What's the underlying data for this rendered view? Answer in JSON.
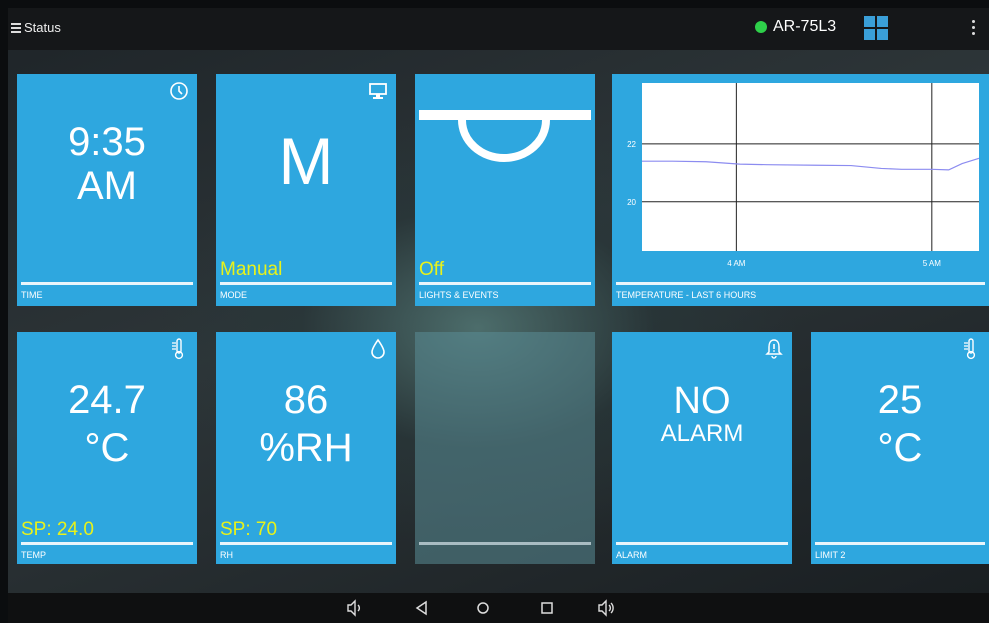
{
  "statusbar": {
    "title": "Status",
    "device_name": "AR-75L3",
    "connection_color": "#2ed04a",
    "icons": [
      "hamburger-icon",
      "dashboard-grid-icon",
      "overflow-menu-icon"
    ]
  },
  "tiles": {
    "time": {
      "value_line1": "9:35",
      "value_line2": "AM",
      "label": "TIME",
      "icon": "clock-icon"
    },
    "mode": {
      "value": "M",
      "sub": "Manual",
      "label": "MODE",
      "icon": "monitor-icon"
    },
    "lights": {
      "sub": "Off",
      "label": "LIGHTS & EVENTS",
      "icon": "light-fixture-icon"
    },
    "temperature_chart": {
      "label": "TEMPERATURE - LAST 6 HOURS"
    },
    "temp": {
      "value_line1": "24.7",
      "value_line2": "°C",
      "sub": "SP: 24.0",
      "label": "TEMP",
      "icon": "thermometer-icon"
    },
    "rh": {
      "value_line1": "86",
      "value_line2": "%RH",
      "sub": "SP: 70",
      "label": "RH",
      "icon": "droplet-icon"
    },
    "alarm": {
      "value_line1": "NO",
      "value_line2": "ALARM",
      "label": "ALARM",
      "icon": "alarm-bell-icon"
    },
    "limit2": {
      "value_line1": "25",
      "value_line2": "°C",
      "label": "LIMIT 2",
      "icon": "thermometer-icon"
    }
  },
  "chart_data": {
    "type": "line",
    "title": "",
    "xlabel": "",
    "ylabel": "",
    "x_ticks": [
      "4 AM",
      "5 AM"
    ],
    "y_ticks": [
      20,
      22
    ],
    "ylim": [
      18.3,
      24.1
    ],
    "x": [
      0,
      0.09,
      0.19,
      0.29,
      0.37,
      0.52,
      0.62,
      0.71,
      0.77,
      0.86,
      0.91,
      0.95,
      1.0
    ],
    "series": [
      {
        "values": [
          21.4,
          21.4,
          21.38,
          21.3,
          21.28,
          21.26,
          21.25,
          21.15,
          21.12,
          21.12,
          21.1,
          21.32,
          21.5
        ]
      }
    ],
    "grid": true,
    "line_color": "#8c8cf0"
  },
  "navbar": {
    "icons": [
      "volume-down-icon",
      "back-icon",
      "home-icon",
      "recents-icon",
      "volume-up-icon"
    ]
  }
}
